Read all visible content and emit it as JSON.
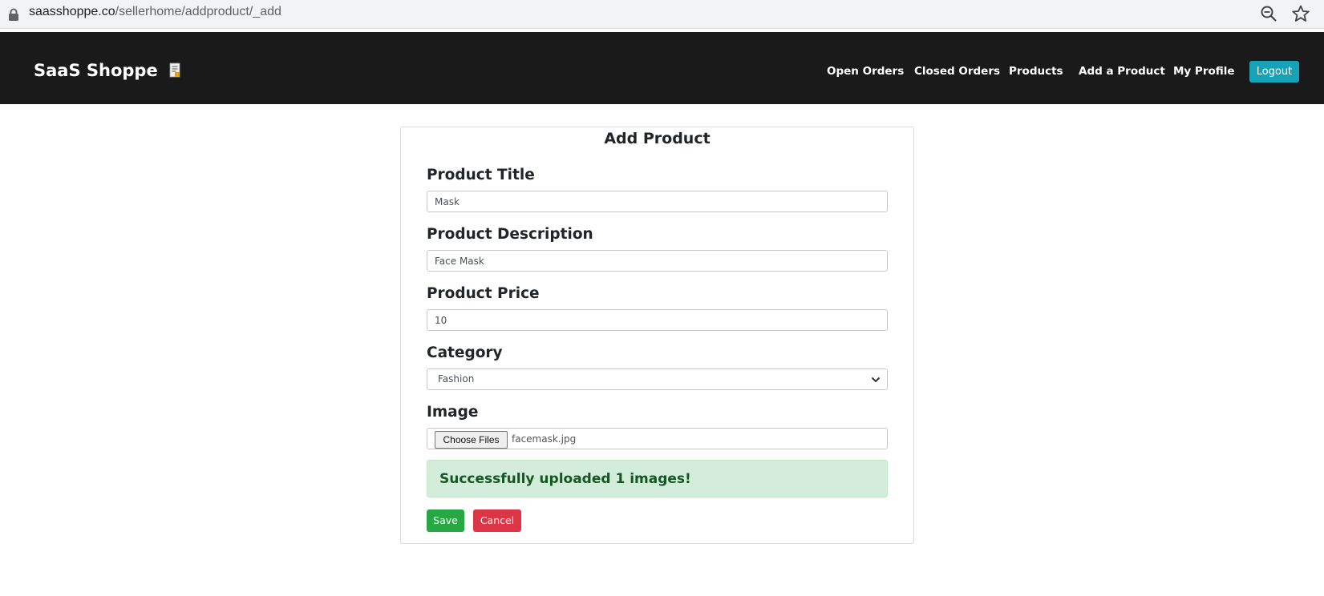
{
  "browser": {
    "url_host": "saasshoppe.co",
    "url_path": "/sellerhome/addproduct/_add"
  },
  "navbar": {
    "brand": "SaaS Shoppe",
    "links": [
      "Open Orders",
      "Closed Orders",
      "Products",
      "Add a Product",
      "My Profile"
    ],
    "logout_label": "Logout",
    "logout_color": "#17a2b8"
  },
  "form": {
    "title": "Add Product",
    "product_title_label": "Product Title",
    "product_title_value": "Mask",
    "product_description_label": "Product Description",
    "product_description_value": "Face Mask",
    "product_price_label": "Product Price",
    "product_price_value": "10",
    "category_label": "Category",
    "category_value": "Fashion",
    "image_label": "Image",
    "choose_files_label": "Choose Files",
    "file_name": "facemask.jpg",
    "success_message": "Successfully uploaded 1 images!",
    "save_label": "Save",
    "cancel_label": "Cancel"
  },
  "icons": {
    "lock": "lock-icon",
    "zoom": "zoom-out-icon",
    "star": "star-icon",
    "brand": "receipt-icon",
    "select": "chevron-down-icon"
  },
  "colors": {
    "navbar_bg": "#1b1a1a",
    "save": "#28a745",
    "cancel": "#dc3545",
    "alert_bg": "#d4edda",
    "alert_text": "#155724"
  }
}
